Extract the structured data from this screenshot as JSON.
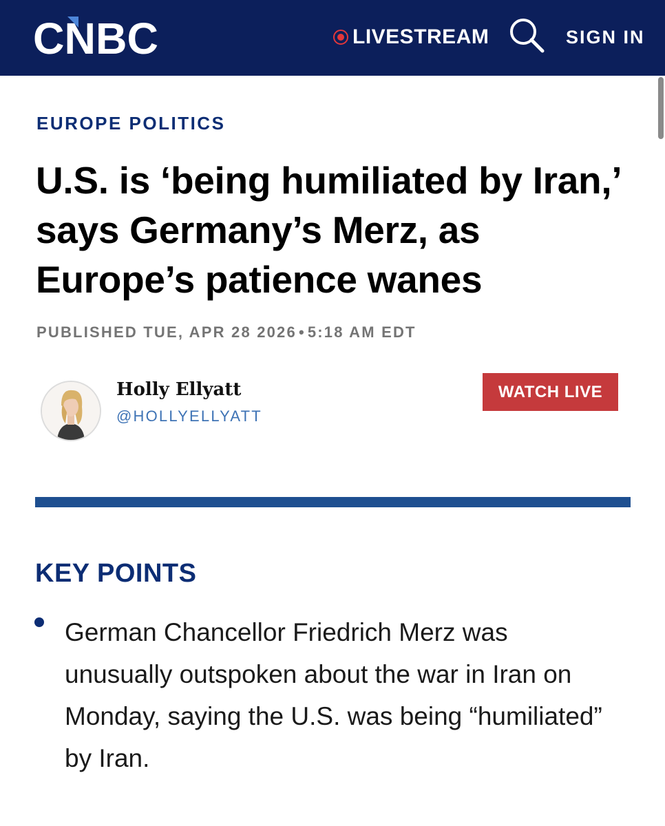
{
  "header": {
    "logo_text": "CNBC",
    "livestream_label": "LIVESTREAM",
    "search_icon": "search-icon",
    "signin_label": "SIGN IN",
    "colors": {
      "background": "#0c1f5b",
      "live_red": "#e3373a"
    }
  },
  "article": {
    "section": "EUROPE POLITICS",
    "headline": "U.S. is ‘being humiliated by Iran,’ says Germany’s Merz, as Europe’s patience wanes",
    "published_label": "PUBLISHED TUE, APR 28 2026",
    "separator": "•",
    "published_time": "5:18 AM EDT",
    "author": {
      "name": "Holly Ellyatt",
      "handle": "@HOLLYELLYATT"
    },
    "watch_live_label": "WATCH LIVE",
    "colors": {
      "section": "#0c2d74",
      "watch_live": "#c53a3c",
      "divider": "#1e4f90",
      "handle": "#3e73b5"
    }
  },
  "key_points": {
    "title": "KEY POINTS",
    "items": [
      "German Chancellor Friedrich Merz was unusually outspoken about the war in Iran on Monday, saying the U.S. was being “humiliated” by Iran."
    ]
  }
}
